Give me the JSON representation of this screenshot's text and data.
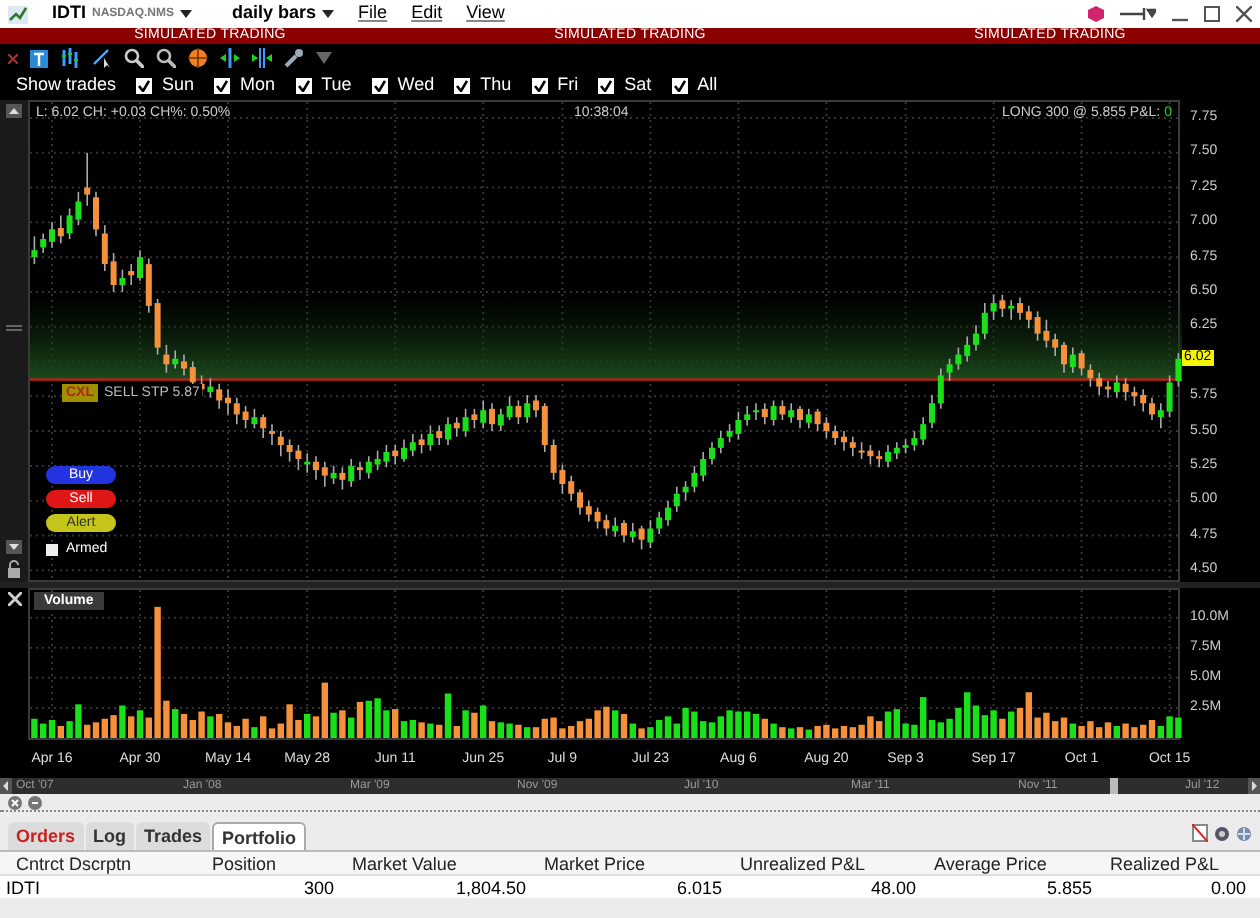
{
  "window": {
    "symbol": "IDTI",
    "exchange": "NASDAQ.NMS",
    "period": "daily bars",
    "menus": [
      "File",
      "Edit",
      "View"
    ]
  },
  "banners": [
    "SIMULATED TRADING",
    "SIMULATED TRADING",
    "SIMULATED TRADING"
  ],
  "filters": {
    "label": "Show trades",
    "days": [
      {
        "label": "Sun",
        "checked": true
      },
      {
        "label": "Mon",
        "checked": true
      },
      {
        "label": "Tue",
        "checked": true
      },
      {
        "label": "Wed",
        "checked": true
      },
      {
        "label": "Thu",
        "checked": true
      },
      {
        "label": "Fri",
        "checked": true
      },
      {
        "label": "Sat",
        "checked": true
      },
      {
        "label": "All",
        "checked": true
      }
    ]
  },
  "quote": {
    "summary": "L: 6.02 CH: +0.03 CH%: 0.50%",
    "time": "10:38:04",
    "position": "LONG 300 @ 5.855 P&L:",
    "pnl": "0"
  },
  "price_chart": {
    "chart_data": {
      "type": "candlestick",
      "grid": true,
      "ref_lines": [
        {
          "axis": "y",
          "value": 5.87,
          "color": "#d01a1a"
        }
      ],
      "ohlc": [
        [
          6.75,
          6.9,
          6.7,
          6.8
        ],
        [
          6.82,
          6.92,
          6.78,
          6.88
        ],
        [
          6.86,
          7.0,
          6.82,
          6.95
        ],
        [
          6.96,
          7.05,
          6.85,
          6.9
        ],
        [
          6.92,
          7.1,
          6.88,
          7.05
        ],
        [
          7.02,
          7.22,
          6.98,
          7.15
        ],
        [
          7.25,
          7.5,
          7.12,
          7.2
        ],
        [
          7.18,
          7.22,
          6.9,
          6.95
        ],
        [
          6.92,
          6.98,
          6.65,
          6.7
        ],
        [
          6.72,
          6.78,
          6.5,
          6.55
        ],
        [
          6.55,
          6.66,
          6.5,
          6.6
        ],
        [
          6.65,
          6.7,
          6.55,
          6.62
        ],
        [
          6.6,
          6.8,
          6.58,
          6.75
        ],
        [
          6.7,
          6.74,
          6.35,
          6.4
        ],
        [
          6.42,
          6.45,
          6.05,
          6.1
        ],
        [
          6.05,
          6.12,
          5.92,
          5.98
        ],
        [
          5.98,
          6.08,
          5.95,
          6.02
        ],
        [
          6.0,
          6.05,
          5.9,
          5.95
        ],
        [
          5.96,
          6.0,
          5.82,
          5.85
        ],
        [
          5.84,
          5.9,
          5.75,
          5.8
        ],
        [
          5.78,
          5.88,
          5.74,
          5.82
        ],
        [
          5.8,
          5.84,
          5.66,
          5.72
        ],
        [
          5.74,
          5.8,
          5.62,
          5.7
        ],
        [
          5.7,
          5.74,
          5.55,
          5.62
        ],
        [
          5.64,
          5.68,
          5.52,
          5.58
        ],
        [
          5.55,
          5.66,
          5.52,
          5.6
        ],
        [
          5.6,
          5.62,
          5.45,
          5.52
        ],
        [
          5.5,
          5.55,
          5.4,
          5.48
        ],
        [
          5.46,
          5.5,
          5.32,
          5.4
        ],
        [
          5.4,
          5.44,
          5.28,
          5.35
        ],
        [
          5.36,
          5.4,
          5.22,
          5.3
        ],
        [
          5.26,
          5.34,
          5.2,
          5.28
        ],
        [
          5.28,
          5.32,
          5.15,
          5.22
        ],
        [
          5.24,
          5.28,
          5.1,
          5.18
        ],
        [
          5.16,
          5.25,
          5.12,
          5.2
        ],
        [
          5.2,
          5.24,
          5.08,
          5.15
        ],
        [
          5.14,
          5.3,
          5.1,
          5.25
        ],
        [
          5.24,
          5.28,
          5.15,
          5.22
        ],
        [
          5.2,
          5.32,
          5.16,
          5.28
        ],
        [
          5.26,
          5.36,
          5.22,
          5.3
        ],
        [
          5.28,
          5.4,
          5.24,
          5.35
        ],
        [
          5.36,
          5.4,
          5.26,
          5.32
        ],
        [
          5.3,
          5.44,
          5.28,
          5.38
        ],
        [
          5.36,
          5.48,
          5.32,
          5.42
        ],
        [
          5.44,
          5.48,
          5.34,
          5.4
        ],
        [
          5.4,
          5.54,
          5.36,
          5.48
        ],
        [
          5.5,
          5.54,
          5.4,
          5.45
        ],
        [
          5.44,
          5.6,
          5.4,
          5.55
        ],
        [
          5.56,
          5.6,
          5.46,
          5.52
        ],
        [
          5.5,
          5.66,
          5.46,
          5.6
        ],
        [
          5.62,
          5.66,
          5.52,
          5.58
        ],
        [
          5.56,
          5.72,
          5.52,
          5.65
        ],
        [
          5.66,
          5.7,
          5.5,
          5.55
        ],
        [
          5.54,
          5.66,
          5.5,
          5.62
        ],
        [
          5.6,
          5.75,
          5.58,
          5.68
        ],
        [
          5.68,
          5.72,
          5.55,
          5.6
        ],
        [
          5.6,
          5.76,
          5.56,
          5.7
        ],
        [
          5.72,
          5.76,
          5.6,
          5.65
        ],
        [
          5.68,
          5.7,
          5.35,
          5.4
        ],
        [
          5.4,
          5.44,
          5.15,
          5.2
        ],
        [
          5.22,
          5.26,
          5.05,
          5.12
        ],
        [
          5.14,
          5.18,
          5.0,
          5.05
        ],
        [
          5.06,
          5.08,
          4.9,
          4.95
        ],
        [
          4.96,
          5.0,
          4.85,
          4.9
        ],
        [
          4.92,
          4.95,
          4.8,
          4.85
        ],
        [
          4.86,
          4.9,
          4.75,
          4.8
        ],
        [
          4.78,
          4.88,
          4.74,
          4.82
        ],
        [
          4.84,
          4.86,
          4.7,
          4.75
        ],
        [
          4.74,
          4.84,
          4.7,
          4.78
        ],
        [
          4.8,
          4.82,
          4.65,
          4.72
        ],
        [
          4.7,
          4.86,
          4.66,
          4.8
        ],
        [
          4.8,
          4.92,
          4.76,
          4.88
        ],
        [
          4.86,
          5.0,
          4.82,
          4.95
        ],
        [
          4.96,
          5.1,
          4.92,
          5.05
        ],
        [
          5.06,
          5.14,
          5.0,
          5.1
        ],
        [
          5.1,
          5.25,
          5.06,
          5.2
        ],
        [
          5.18,
          5.35,
          5.14,
          5.3
        ],
        [
          5.3,
          5.42,
          5.26,
          5.38
        ],
        [
          5.38,
          5.5,
          5.34,
          5.45
        ],
        [
          5.46,
          5.55,
          5.42,
          5.5
        ],
        [
          5.48,
          5.64,
          5.44,
          5.58
        ],
        [
          5.58,
          5.68,
          5.54,
          5.62
        ],
        [
          5.64,
          5.7,
          5.58,
          5.65
        ],
        [
          5.66,
          5.7,
          5.55,
          5.6
        ],
        [
          5.58,
          5.72,
          5.54,
          5.68
        ],
        [
          5.68,
          5.72,
          5.58,
          5.62
        ],
        [
          5.6,
          5.7,
          5.56,
          5.65
        ],
        [
          5.66,
          5.68,
          5.52,
          5.58
        ],
        [
          5.56,
          5.66,
          5.52,
          5.62
        ],
        [
          5.64,
          5.66,
          5.5,
          5.55
        ],
        [
          5.56,
          5.6,
          5.45,
          5.5
        ],
        [
          5.5,
          5.54,
          5.4,
          5.45
        ],
        [
          5.46,
          5.5,
          5.36,
          5.42
        ],
        [
          5.42,
          5.46,
          5.32,
          5.38
        ],
        [
          5.36,
          5.42,
          5.3,
          5.35
        ],
        [
          5.36,
          5.4,
          5.26,
          5.32
        ],
        [
          5.32,
          5.36,
          5.24,
          5.3
        ],
        [
          5.28,
          5.4,
          5.24,
          5.35
        ],
        [
          5.34,
          5.42,
          5.3,
          5.38
        ],
        [
          5.38,
          5.44,
          5.34,
          5.4
        ],
        [
          5.4,
          5.5,
          5.36,
          5.45
        ],
        [
          5.44,
          5.6,
          5.4,
          5.55
        ],
        [
          5.56,
          5.76,
          5.52,
          5.7
        ],
        [
          5.7,
          5.95,
          5.66,
          5.9
        ],
        [
          5.92,
          6.02,
          5.86,
          5.98
        ],
        [
          5.98,
          6.1,
          5.94,
          6.05
        ],
        [
          6.04,
          6.18,
          6.0,
          6.12
        ],
        [
          6.12,
          6.26,
          6.08,
          6.2
        ],
        [
          6.2,
          6.42,
          6.16,
          6.35
        ],
        [
          6.36,
          6.48,
          6.3,
          6.42
        ],
        [
          6.44,
          6.48,
          6.32,
          6.38
        ],
        [
          6.38,
          6.44,
          6.3,
          6.4
        ],
        [
          6.42,
          6.46,
          6.3,
          6.35
        ],
        [
          6.36,
          6.4,
          6.24,
          6.3
        ],
        [
          6.32,
          6.36,
          6.15,
          6.2
        ],
        [
          6.22,
          6.3,
          6.1,
          6.15
        ],
        [
          6.16,
          6.2,
          6.04,
          6.1
        ],
        [
          6.12,
          6.14,
          5.92,
          5.98
        ],
        [
          5.96,
          6.1,
          5.92,
          6.05
        ],
        [
          6.06,
          6.08,
          5.9,
          5.95
        ],
        [
          5.94,
          5.98,
          5.82,
          5.88
        ],
        [
          5.88,
          5.92,
          5.76,
          5.82
        ],
        [
          5.82,
          5.86,
          5.74,
          5.8
        ],
        [
          5.78,
          5.9,
          5.74,
          5.85
        ],
        [
          5.84,
          5.88,
          5.72,
          5.78
        ],
        [
          5.78,
          5.82,
          5.68,
          5.75
        ],
        [
          5.76,
          5.8,
          5.64,
          5.7
        ],
        [
          5.7,
          5.74,
          5.58,
          5.62
        ],
        [
          5.6,
          5.7,
          5.52,
          5.65
        ],
        [
          5.64,
          5.9,
          5.6,
          5.85
        ],
        [
          5.86,
          6.06,
          5.82,
          6.02
        ]
      ],
      "ylim": [
        4.43,
        7.865
      ],
      "yticks": [
        {
          "value": 7.75,
          "label": "7.75"
        },
        {
          "value": 7.5,
          "label": "7.50"
        },
        {
          "value": 7.25,
          "label": "7.25"
        },
        {
          "value": 7,
          "label": "7.00"
        },
        {
          "value": 6.75,
          "label": "6.75"
        },
        {
          "value": 6.5,
          "label": "6.50"
        },
        {
          "value": 6.25,
          "label": "6.25"
        },
        {
          "value": 5.75,
          "label": "5.75"
        },
        {
          "value": 5.5,
          "label": "5.50"
        },
        {
          "value": 5.25,
          "label": "5.25"
        },
        {
          "value": 5,
          "label": "5.00"
        },
        {
          "value": 4.75,
          "label": "4.75"
        },
        {
          "value": 4.5,
          "label": "4.50"
        }
      ]
    }
  },
  "last_price": "6.02",
  "order": {
    "cancel": "CXL",
    "label": "SELL STP 5.87"
  },
  "buttons": [
    {
      "label": "Buy",
      "kind": "buy"
    },
    {
      "label": "Sell",
      "kind": "sell"
    },
    {
      "label": "Alert",
      "kind": "alert"
    }
  ],
  "armed": {
    "label": "Armed",
    "checked": false
  },
  "volume": {
    "title": "Volume",
    "chart_data": {
      "type": "bar",
      "grid": true,
      "categories": [
        null,
        null,
        "Apr 16",
        null,
        null,
        null,
        null,
        null,
        null,
        null,
        null,
        null,
        "Apr 30",
        null,
        null,
        null,
        null,
        null,
        null,
        null,
        null,
        null,
        "May 14",
        null,
        null,
        null,
        null,
        null,
        null,
        null,
        null,
        "May 28",
        null,
        null,
        null,
        null,
        null,
        null,
        null,
        null,
        null,
        "Jun 11",
        null,
        null,
        null,
        null,
        null,
        null,
        null,
        null,
        null,
        "Jun 25",
        null,
        null,
        null,
        null,
        null,
        null,
        null,
        null,
        "Jul 9",
        null,
        null,
        null,
        null,
        null,
        null,
        null,
        null,
        null,
        "Jul 23",
        null,
        null,
        null,
        null,
        null,
        null,
        null,
        null,
        null,
        "Aug 6",
        null,
        null,
        null,
        null,
        null,
        null,
        null,
        null,
        null,
        "Aug 20",
        null,
        null,
        null,
        null,
        null,
        null,
        null,
        null,
        "Sep 3",
        null,
        null,
        null,
        null,
        null,
        null,
        null,
        null,
        null,
        "Sep 17",
        null,
        null,
        null,
        null,
        null,
        null,
        null,
        null,
        null,
        "Oct 1",
        null,
        null,
        null,
        null,
        null,
        null,
        null,
        null,
        null,
        "Oct 15",
        null
      ],
      "values": [
        1.6,
        1.2,
        1.5,
        1.0,
        1.4,
        2.8,
        1.1,
        1.3,
        1.6,
        1.9,
        2.7,
        1.8,
        2.3,
        1.7,
        10.9,
        3.1,
        2.4,
        2.0,
        1.5,
        2.2,
        1.8,
        2.0,
        1.3,
        1.0,
        1.6,
        0.9,
        1.8,
        0.8,
        1.2,
        2.8,
        1.5,
        2.0,
        1.8,
        4.6,
        2.1,
        2.3,
        1.7,
        3.0,
        3.1,
        3.3,
        2.3,
        2.4,
        1.4,
        1.5,
        1.3,
        1.2,
        1.1,
        3.7,
        1.0,
        2.3,
        2.1,
        2.7,
        1.4,
        1.3,
        1.2,
        1.1,
        0.9,
        0.9,
        1.6,
        1.7,
        0.8,
        1.0,
        1.4,
        1.6,
        2.3,
        2.6,
        2.3,
        2.0,
        1.2,
        0.8,
        0.9,
        1.5,
        1.8,
        1.2,
        2.5,
        2.2,
        1.4,
        1.3,
        1.8,
        2.3,
        2.2,
        2.2,
        2.0,
        1.6,
        1.2,
        0.9,
        0.8,
        0.9,
        0.7,
        1.0,
        1.1,
        0.8,
        1.0,
        0.9,
        1.1,
        1.8,
        1.4,
        2.2,
        2.4,
        1.2,
        1.1,
        3.4,
        1.5,
        1.3,
        1.6,
        2.5,
        3.8,
        2.7,
        1.9,
        2.3,
        1.6,
        2.2,
        2.5,
        3.8,
        1.7,
        2.1,
        1.4,
        1.7,
        1.2,
        1.0,
        1.4,
        0.9,
        1.3,
        1.0,
        1.2,
        0.9,
        1.1,
        1.5,
        1.0,
        1.8,
        1.7
      ],
      "ylim": [
        0,
        12.3
      ],
      "yticks": [
        {
          "value": 10,
          "label": "10.0M"
        },
        {
          "value": 7.5,
          "label": "7.5M"
        },
        {
          "value": 5,
          "label": "5.0M"
        },
        {
          "value": 2.5,
          "label": "2.5M"
        }
      ]
    }
  },
  "navigator": [
    "Oct '07",
    "Jan '08",
    "Mar '09",
    "Nov '09",
    "Jul '10",
    "Mar '11",
    "Nov '11",
    "Jul '12"
  ],
  "tabs": [
    {
      "label": "Orders",
      "selected": false,
      "color": "#cc1f1f"
    },
    {
      "label": "Log",
      "selected": false,
      "color": "#333333"
    },
    {
      "label": "Trades",
      "selected": false,
      "color": "#333333"
    },
    {
      "label": "Portfolio",
      "selected": true,
      "color": "#333333"
    }
  ],
  "table": {
    "columns": [
      "Cntrct Dscrptn",
      "Position",
      "Market Value",
      "Market Price",
      "Unrealized P&L",
      "Average Price",
      "Realized P&L"
    ],
    "rows": [
      [
        "IDTI",
        "300",
        "1,804.50",
        "6.015",
        "48.00",
        "5.855",
        "0.00"
      ]
    ]
  }
}
